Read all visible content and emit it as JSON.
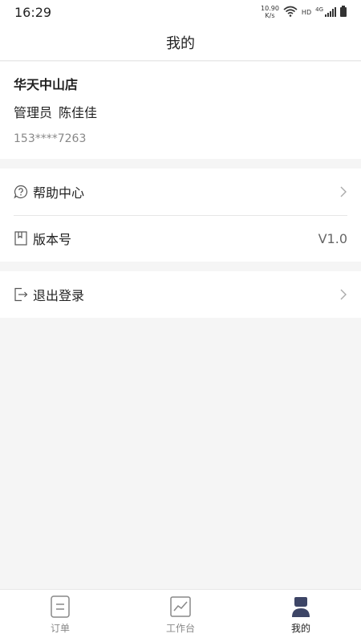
{
  "status_bar": {
    "time": "16:29",
    "net_speed_value": "10.90",
    "net_speed_unit": "K/s",
    "hd": "HD",
    "network": "4G"
  },
  "nav": {
    "title": "我的"
  },
  "profile": {
    "store_name": "华天中山店",
    "role": "管理员",
    "user_name": "陈佳佳",
    "phone": "153****7263"
  },
  "menu": {
    "help": {
      "label": "帮助中心",
      "icon": "help-circle-icon"
    },
    "version": {
      "label": "版本号",
      "value": "V1.0",
      "icon": "book-icon"
    },
    "logout": {
      "label": "退出登录",
      "icon": "logout-icon"
    }
  },
  "tabs": [
    {
      "label": "订单",
      "icon": "document-icon",
      "active": false
    },
    {
      "label": "工作台",
      "icon": "chart-icon",
      "active": false
    },
    {
      "label": "我的",
      "icon": "user-icon",
      "active": true
    }
  ],
  "colors": {
    "background": "#f5f5f5",
    "active_tab_icon": "#3d4566"
  }
}
